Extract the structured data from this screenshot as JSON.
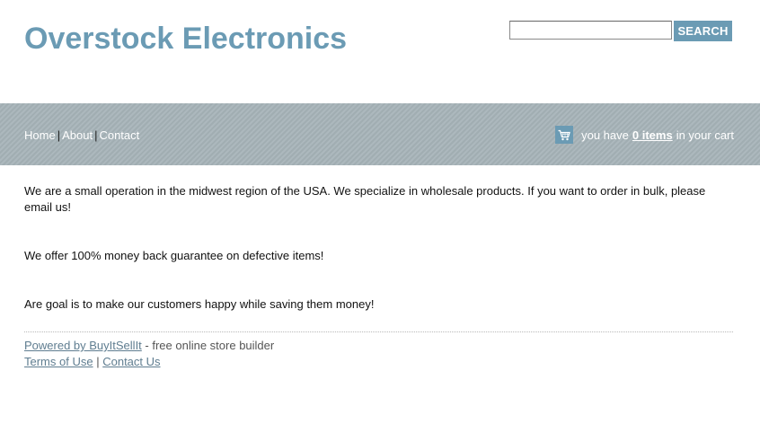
{
  "header": {
    "site_title": "Overstock Electronics",
    "search": {
      "value": "",
      "placeholder": "",
      "button_label": "SEARCH"
    }
  },
  "nav": {
    "links": [
      "Home",
      "About",
      "Contact"
    ],
    "separator": "|"
  },
  "cart": {
    "prefix": "you have",
    "count_label": "0 items",
    "suffix": "in your cart",
    "icon": "shopping-cart-icon"
  },
  "content": {
    "paragraphs": [
      "We are a small operation in the midwest region of the USA.  We specialize in wholesale products.  If you want to order in bulk, please email us!",
      "We offer 100% money back guarantee on defective items!",
      "Are goal is to make our customers happy while saving them money!"
    ]
  },
  "footer": {
    "powered_by_link": "Powered by BuyItSellIt",
    "powered_by_suffix": "- free online store builder",
    "terms_link": "Terms of Use",
    "separator": "|",
    "contact_link": "Contact Us"
  },
  "colors": {
    "brand": "#6b9bb4",
    "navbar": "#a6b3b8",
    "link": "#5f7d90"
  }
}
